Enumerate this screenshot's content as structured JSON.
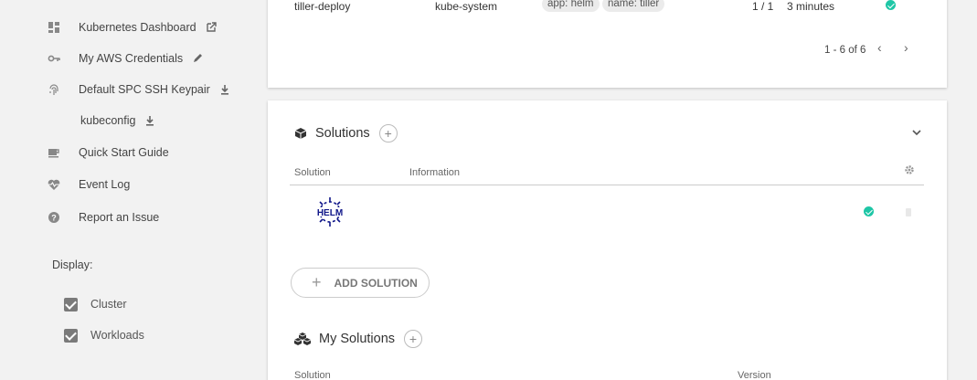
{
  "sidebar": {
    "items": [
      {
        "label": "Kubernetes Dashboard",
        "icon": "dashboard-icon",
        "trail": "external-link-icon"
      },
      {
        "label": "My AWS Credentials",
        "icon": "key-icon",
        "trail": "pencil-icon"
      },
      {
        "label": "Default SPC SSH Keypair",
        "icon": "fingerprint-icon",
        "trail": "download-icon"
      },
      {
        "label": "kubeconfig",
        "icon": "",
        "trail": "download-icon"
      },
      {
        "label": "Quick Start Guide",
        "icon": "coffee-icon",
        "trail": ""
      },
      {
        "label": "Event Log",
        "icon": "heartbeat-icon",
        "trail": ""
      },
      {
        "label": "Report an Issue",
        "icon": "help-icon",
        "trail": ""
      }
    ],
    "display_label": "Display:",
    "checkboxes": [
      {
        "label": "Cluster",
        "checked": true
      },
      {
        "label": "Workloads",
        "checked": true
      }
    ]
  },
  "deployments": {
    "row": {
      "name": "tiller-deploy",
      "namespace": "kube-system",
      "labels": [
        "app: helm",
        "name: tiller"
      ],
      "pods": "1 / 1",
      "age": "3 minutes",
      "status_color": "#1ec6a6"
    },
    "pagination": "1 - 6 of 6"
  },
  "solutions": {
    "title": "Solutions",
    "columns": [
      "Solution",
      "Information"
    ],
    "rows": [
      {
        "logo_text": "HELM",
        "status_color": "#1ec6a6"
      }
    ],
    "add_button": "ADD SOLUTION"
  },
  "my_solutions": {
    "title": "My Solutions",
    "columns": [
      "Solution",
      "Version"
    ]
  }
}
